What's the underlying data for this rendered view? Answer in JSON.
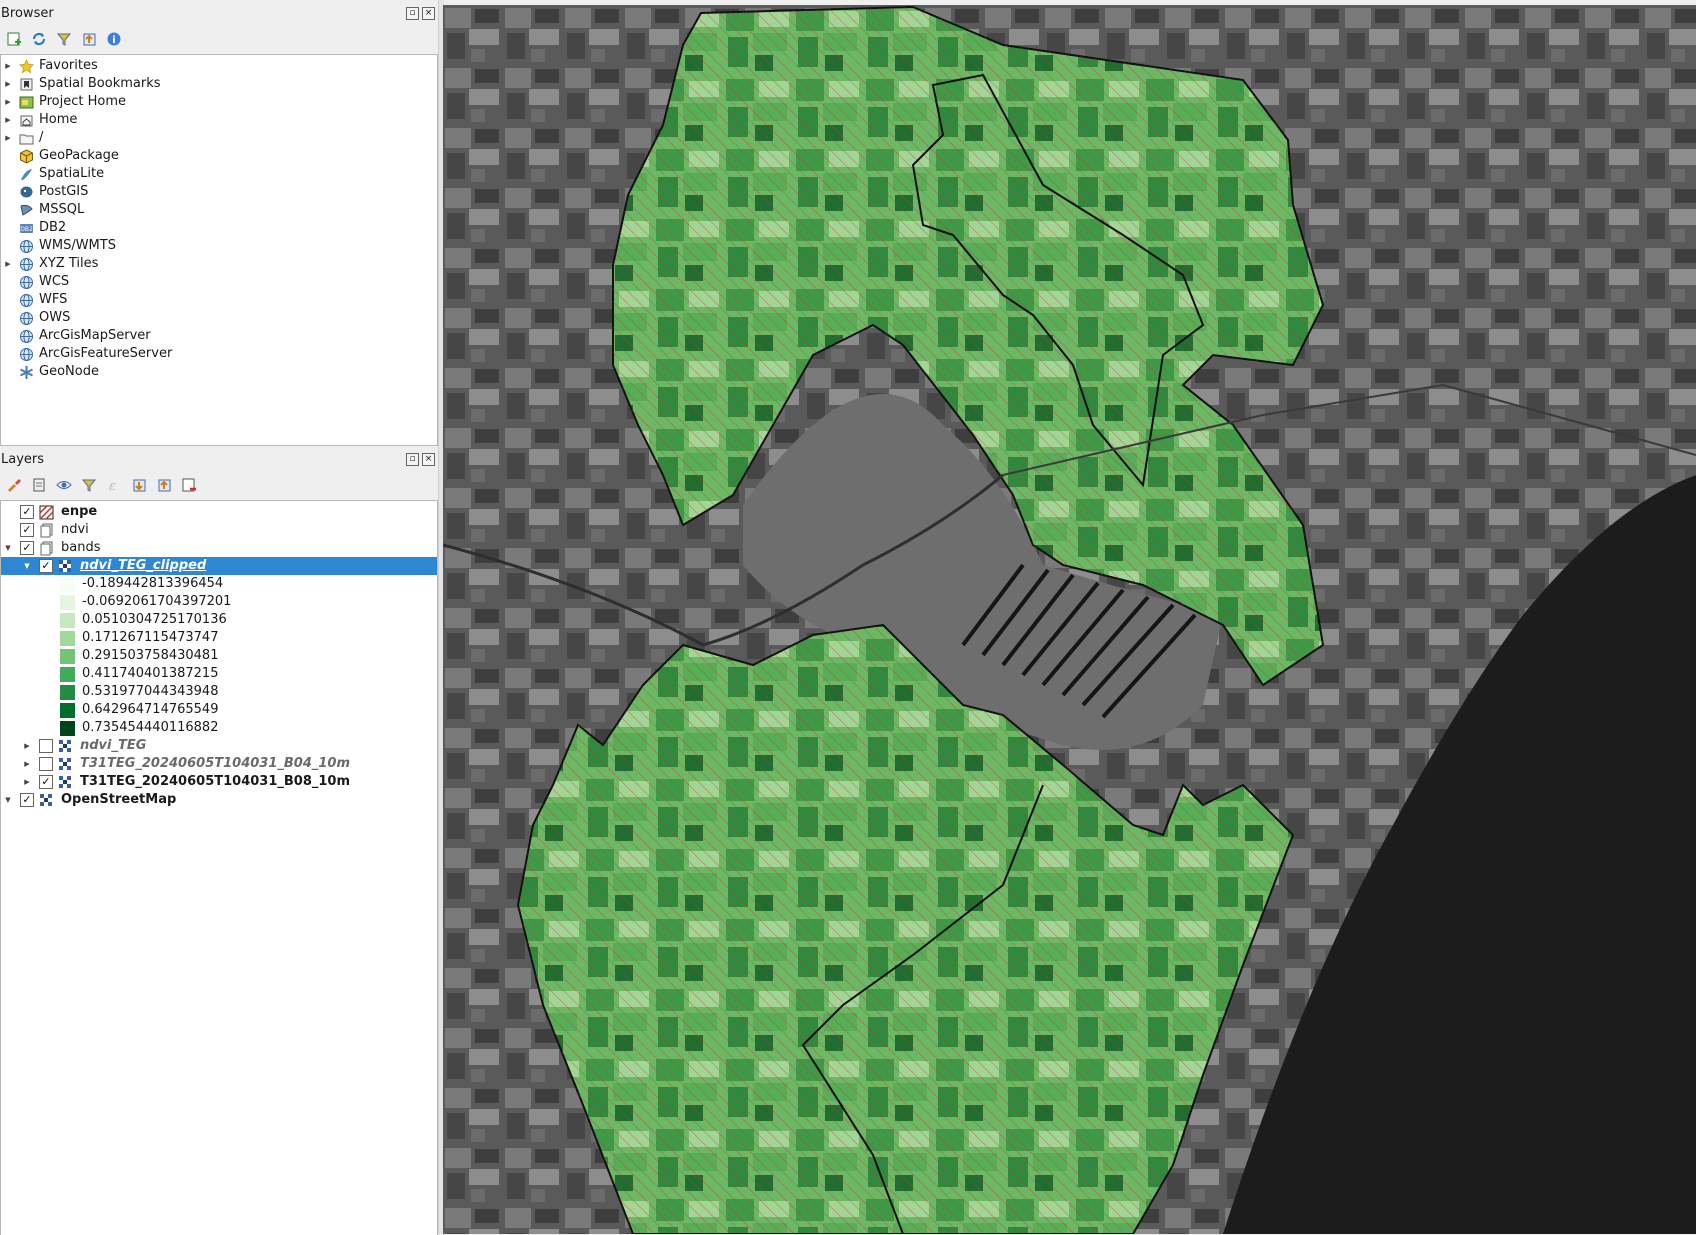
{
  "browser": {
    "title": "Browser",
    "items": [
      {
        "label": "Favorites",
        "icon": "star-icon",
        "expandable": true
      },
      {
        "label": "Spatial Bookmarks",
        "icon": "bookmark-icon",
        "expandable": true
      },
      {
        "label": "Project Home",
        "icon": "project-home-icon",
        "expandable": true
      },
      {
        "label": "Home",
        "icon": "home-folder-icon",
        "expandable": true
      },
      {
        "label": "/",
        "icon": "folder-icon",
        "expandable": true
      },
      {
        "label": "GeoPackage",
        "icon": "geopackage-icon",
        "expandable": false
      },
      {
        "label": "SpatiaLite",
        "icon": "spatialite-icon",
        "expandable": false
      },
      {
        "label": "PostGIS",
        "icon": "postgis-icon",
        "expandable": false
      },
      {
        "label": "MSSQL",
        "icon": "mssql-icon",
        "expandable": false
      },
      {
        "label": "DB2",
        "icon": "db2-icon",
        "expandable": false
      },
      {
        "label": "WMS/WMTS",
        "icon": "globe-icon",
        "expandable": false
      },
      {
        "label": "XYZ Tiles",
        "icon": "globe-icon",
        "expandable": true
      },
      {
        "label": "WCS",
        "icon": "globe-icon",
        "expandable": false
      },
      {
        "label": "WFS",
        "icon": "globe-icon",
        "expandable": false
      },
      {
        "label": "OWS",
        "icon": "globe-icon",
        "expandable": false
      },
      {
        "label": "ArcGisMapServer",
        "icon": "globe-icon",
        "expandable": false
      },
      {
        "label": "ArcGisFeatureServer",
        "icon": "globe-icon",
        "expandable": false
      },
      {
        "label": "GeoNode",
        "icon": "geonode-icon",
        "expandable": false
      }
    ]
  },
  "layers": {
    "title": "Layers",
    "rows": [
      {
        "label": "enpe",
        "bold": true,
        "checked": true,
        "icon": "hatch-polygon-icon",
        "indent": 0,
        "expander": ""
      },
      {
        "label": "ndvi",
        "bold": false,
        "checked": true,
        "icon": "group-icon",
        "indent": 0,
        "expander": ""
      },
      {
        "label": "bands",
        "bold": false,
        "checked": true,
        "icon": "group-icon",
        "indent": 0,
        "expander": "open"
      },
      {
        "label": "ndvi_TEG_clipped",
        "bold": true,
        "italic": true,
        "underline": true,
        "checked": true,
        "icon": "raster-icon",
        "indent": 1,
        "expander": "open",
        "selected": true
      },
      {
        "legend": true,
        "label": "-0.189442813396454",
        "color": "#f7fcf5"
      },
      {
        "legend": true,
        "label": "-0.0692061704397201",
        "color": "#e5f5e0"
      },
      {
        "legend": true,
        "label": "0.0510304725170136",
        "color": "#c7e9c0"
      },
      {
        "legend": true,
        "label": "0.171267115473747",
        "color": "#a1d99b"
      },
      {
        "legend": true,
        "label": "0.291503758430481",
        "color": "#74c476"
      },
      {
        "legend": true,
        "label": "0.411740401387215",
        "color": "#41ab5d"
      },
      {
        "legend": true,
        "label": "0.531977044343948",
        "color": "#238b45"
      },
      {
        "legend": true,
        "label": "0.642964714765549",
        "color": "#006d2c"
      },
      {
        "legend": true,
        "label": "0.735454440116882",
        "color": "#00441b"
      },
      {
        "label": "ndvi_TEG",
        "bold": true,
        "italic": true,
        "grey": true,
        "checked": false,
        "icon": "raster-icon",
        "indent": 1,
        "expander": "closed"
      },
      {
        "label": "T31TEG_20240605T104031_B04_10m",
        "bold": true,
        "italic": true,
        "grey": true,
        "checked": false,
        "icon": "raster-icon",
        "indent": 1,
        "expander": "closed"
      },
      {
        "label": "T31TEG_20240605T104031_B08_10m",
        "bold": true,
        "checked": true,
        "icon": "raster-icon",
        "indent": 1,
        "expander": "closed"
      },
      {
        "label": "OpenStreetMap",
        "bold": true,
        "checked": true,
        "icon": "raster-icon",
        "indent": 0,
        "expander": "open"
      }
    ]
  },
  "colors": {
    "selection": "#2f86d1",
    "hatch": "#c8323c",
    "polygon_fill": "#5fae5a",
    "sea": "#1c1c1c"
  }
}
